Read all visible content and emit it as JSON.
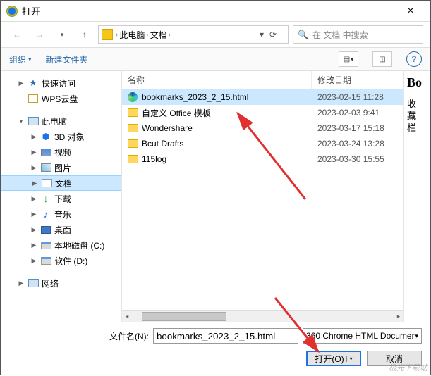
{
  "window": {
    "title": "打开",
    "close_label": "×"
  },
  "breadcrumb": {
    "segments": [
      "此电脑",
      "文档"
    ]
  },
  "search": {
    "placeholder": "在 文档 中搜索"
  },
  "toolbar": {
    "organize": "组织",
    "new_folder": "新建文件夹"
  },
  "columns": {
    "name": "名称",
    "modified": "修改日期"
  },
  "sidebar": {
    "quick_access": "快速访问",
    "wps_cloud": "WPS云盘",
    "this_pc": "此电脑",
    "three_d": "3D 对象",
    "videos": "视频",
    "pictures": "图片",
    "documents": "文档",
    "downloads": "下载",
    "music": "音乐",
    "desktop": "桌面",
    "c_drive": "本地磁盘 (C:)",
    "d_drive": "软件 (D:)",
    "network": "网络"
  },
  "files": [
    {
      "name": "bookmarks_2023_2_15.html",
      "date": "2023-02-15 11:28",
      "type": "html",
      "selected": true
    },
    {
      "name": "自定义 Office 模板",
      "date": "2023-02-03 9:41",
      "type": "folder",
      "selected": false
    },
    {
      "name": "Wondershare",
      "date": "2023-03-17 15:18",
      "type": "folder",
      "selected": false
    },
    {
      "name": "Bcut Drafts",
      "date": "2023-03-24 13:28",
      "type": "folder",
      "selected": false
    },
    {
      "name": "115log",
      "date": "2023-03-30 15:55",
      "type": "folder",
      "selected": false
    }
  ],
  "preview": {
    "title_fragment": "Bo",
    "sub1": "收",
    "sub2": "藏",
    "sub3": "栏"
  },
  "footer": {
    "filename_label": "文件名(N):",
    "filename_value": "bookmarks_2023_2_15.html",
    "filter_value": "360 Chrome HTML Documen",
    "open_btn": "打开(O)",
    "cancel_btn": "取消"
  },
  "watermark": "极光下载站"
}
